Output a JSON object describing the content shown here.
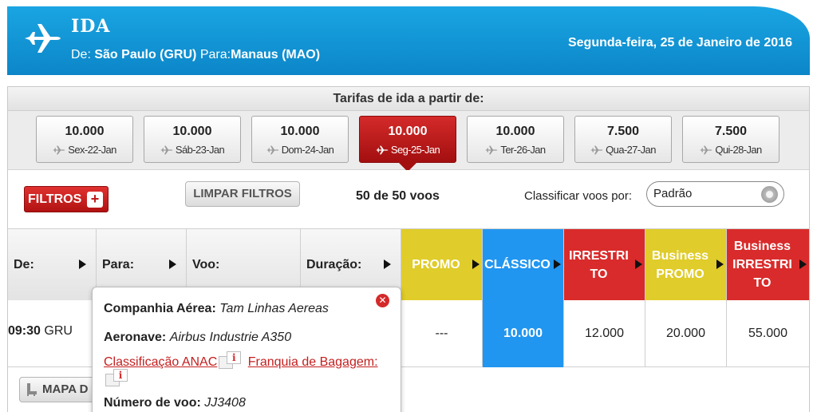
{
  "header": {
    "title": "IDA",
    "route_from_label": "De:",
    "route_from": "São Paulo (GRU)",
    "route_to_label": "Para:",
    "route_to": "Manaus (MAO)",
    "date": "Segunda-feira, 25 de Janeiro de 2016"
  },
  "tarifas": {
    "heading": "Tarifas de ida a partir de:",
    "dates": [
      {
        "price": "10.000",
        "day": "Sex-22-Jan",
        "active": false
      },
      {
        "price": "10.000",
        "day": "Sáb-23-Jan",
        "active": false
      },
      {
        "price": "10.000",
        "day": "Dom-24-Jan",
        "active": false
      },
      {
        "price": "10.000",
        "day": "Seg-25-Jan",
        "active": true
      },
      {
        "price": "10.000",
        "day": "Ter-26-Jan",
        "active": false
      },
      {
        "price": "7.500",
        "day": "Qua-27-Jan",
        "active": false
      },
      {
        "price": "7.500",
        "day": "Qui-28-Jan",
        "active": false
      }
    ]
  },
  "filters": {
    "filtros_label": "FILTROS",
    "plus": "+",
    "limpar_label": "LIMPAR FILTROS",
    "count": "50 de 50 voos",
    "sort_label": "Classificar voos por:",
    "sort_value": "Padrão"
  },
  "table": {
    "columns": {
      "de": "De:",
      "para": "Para:",
      "voo": "Voo:",
      "duracao": "Duração:",
      "promo": "PROMO",
      "classico": "CLÁSSICO",
      "irrestrito": "IRRESTRITO",
      "business_promo": "Business PROMO",
      "business_irrestrito": "Business IRRESTRITO"
    },
    "row": {
      "dep_time": "09:30",
      "dep_airport": "GRU",
      "promo": "---",
      "classico": "10.000",
      "irrestrito": "12.000",
      "business_promo": "20.000",
      "business_irrestrito": "55.000"
    }
  },
  "mapa_label": "MAPA D",
  "popover": {
    "companhia_label": "Companhia Aérea:",
    "companhia": "Tam Linhas Aereas",
    "aeronave_label": "Aeronave:",
    "aeronave": "Airbus Industrie A350",
    "anac_link": "Classificação ANAC",
    "bagagem_link": "Franquia de Bagagem:",
    "info_glyph": "i",
    "numero_label": "Número de voo:",
    "numero": "JJ3408",
    "close": "✕"
  },
  "colors": {
    "header_blue": "#0c86c8",
    "active_red": "#c01818",
    "promo_yellow": "#e0cc2a",
    "classico_blue": "#2196f0",
    "irrestrito_red": "#d92b2b"
  },
  "icons": [
    "airplane-icon",
    "plus-icon",
    "close-icon",
    "info-icon",
    "seat-icon",
    "sort-arrow-icon"
  ]
}
